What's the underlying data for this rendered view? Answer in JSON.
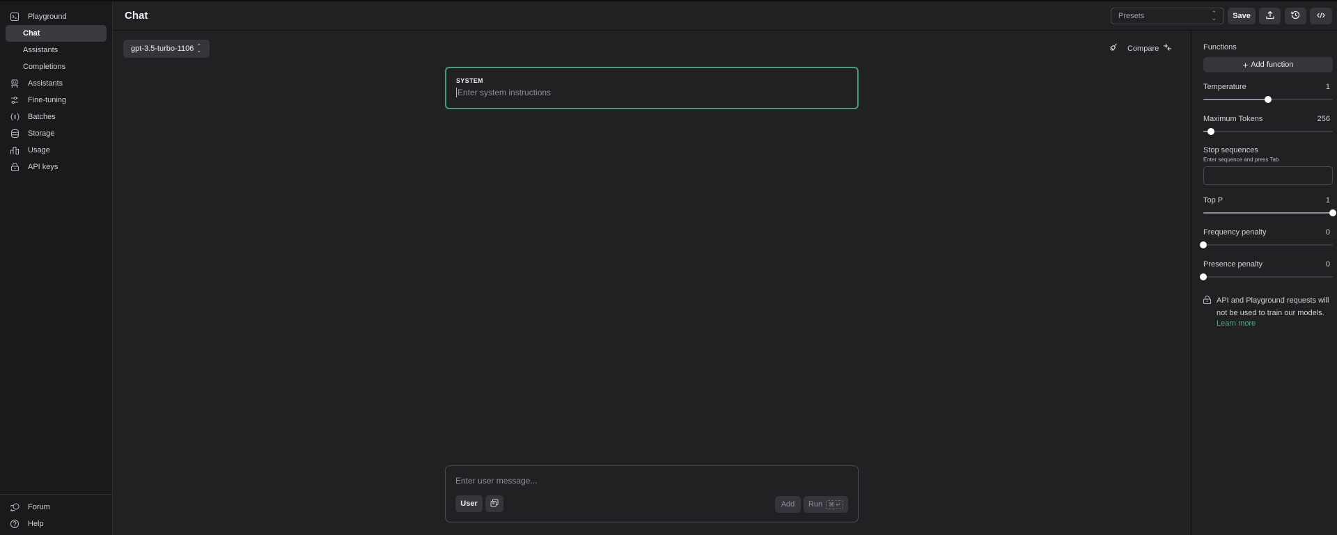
{
  "sidebar": {
    "items": [
      {
        "label": "Playground",
        "icon": "terminal-icon"
      },
      {
        "label": "Chat",
        "sub": true,
        "active": true
      },
      {
        "label": "Assistants",
        "sub": true
      },
      {
        "label": "Completions",
        "sub": true
      },
      {
        "label": "Assistants",
        "icon": "robot-icon"
      },
      {
        "label": "Fine-tuning",
        "icon": "sliders-icon"
      },
      {
        "label": "Batches",
        "icon": "braces-icon"
      },
      {
        "label": "Storage",
        "icon": "database-icon"
      },
      {
        "label": "Usage",
        "icon": "bar-chart-icon"
      },
      {
        "label": "API keys",
        "icon": "lock-icon"
      }
    ],
    "footer": [
      {
        "label": "Forum",
        "icon": "chat-bubbles-icon"
      },
      {
        "label": "Help",
        "icon": "help-circle-icon"
      }
    ]
  },
  "header": {
    "title": "Chat",
    "presets_placeholder": "Presets",
    "save_label": "Save",
    "icons": [
      "upload-icon",
      "history-icon",
      "code-icon"
    ]
  },
  "main": {
    "model": "gpt-3.5-turbo-1106",
    "compare_label": "Compare",
    "system": {
      "label": "SYSTEM",
      "placeholder": "Enter system instructions"
    },
    "composer": {
      "placeholder": "Enter user message...",
      "role_label": "User",
      "add_label": "Add",
      "run_label": "Run",
      "run_shortcut": "⌘ ↵"
    }
  },
  "settings": {
    "functions_label": "Functions",
    "add_function_label": "Add function",
    "temperature": {
      "label": "Temperature",
      "value": "1",
      "fraction": 0.5
    },
    "max_tokens": {
      "label": "Maximum Tokens",
      "value": "256",
      "fraction": 0.06
    },
    "stop_sequences": {
      "label": "Stop sequences",
      "hint": "Enter sequence and press Tab"
    },
    "top_p": {
      "label": "Top P",
      "value": "1",
      "fraction": 1.0
    },
    "frequency_penalty": {
      "label": "Frequency penalty",
      "value": "0",
      "fraction": 0.0
    },
    "presence_penalty": {
      "label": "Presence penalty",
      "value": "0",
      "fraction": 0.0
    },
    "notice": "API and Playground requests will not be used to train our models.",
    "learn_more": "Learn more",
    "accent_color": "#5fa58a",
    "focus_border_color": "#4a9a80"
  }
}
